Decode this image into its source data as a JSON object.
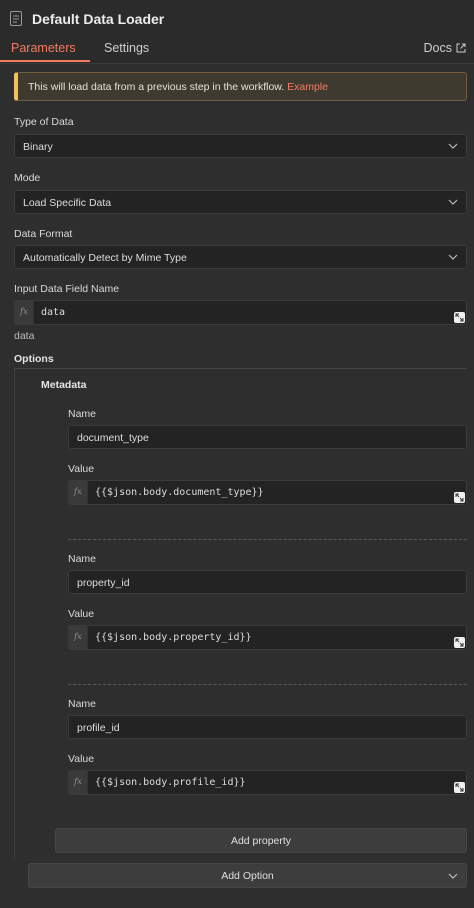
{
  "header": {
    "title": "Default Data Loader",
    "tabs": [
      {
        "label": "Parameters",
        "active": true
      },
      {
        "label": "Settings",
        "active": false
      }
    ],
    "docs_label": "Docs",
    "accent_color": "#f37b61"
  },
  "notice": {
    "text": "This will load data from a previous step in the workflow.",
    "link_text": "Example"
  },
  "fields": {
    "type_of_data": {
      "label": "Type of Data",
      "value": "Binary"
    },
    "mode": {
      "label": "Mode",
      "value": "Load Specific Data"
    },
    "data_format": {
      "label": "Data Format",
      "value": "Automatically Detect by Mime Type"
    },
    "input_field": {
      "label": "Input Data Field Name",
      "value": "data",
      "hint": "data"
    }
  },
  "options": {
    "label": "Options",
    "metadata_label": "Metadata",
    "properties": [
      {
        "name_label": "Name",
        "name_value": "document_type",
        "value_label": "Value",
        "value": "{{$json.body.document_type}}"
      },
      {
        "name_label": "Name",
        "name_value": "property_id",
        "value_label": "Value",
        "value": "{{$json.body.property_id}}"
      },
      {
        "name_label": "Name",
        "name_value": "profile_id",
        "value_label": "Value",
        "value": "{{$json.body.profile_id}}"
      }
    ],
    "add_property_label": "Add property",
    "add_option_label": "Add Option"
  },
  "icons": {
    "fx": "fx",
    "node_icon": "document-icon",
    "docs_icon": "external-link-icon",
    "select_icon": "chevron-down-icon",
    "expand_icon": "expand-icon"
  }
}
